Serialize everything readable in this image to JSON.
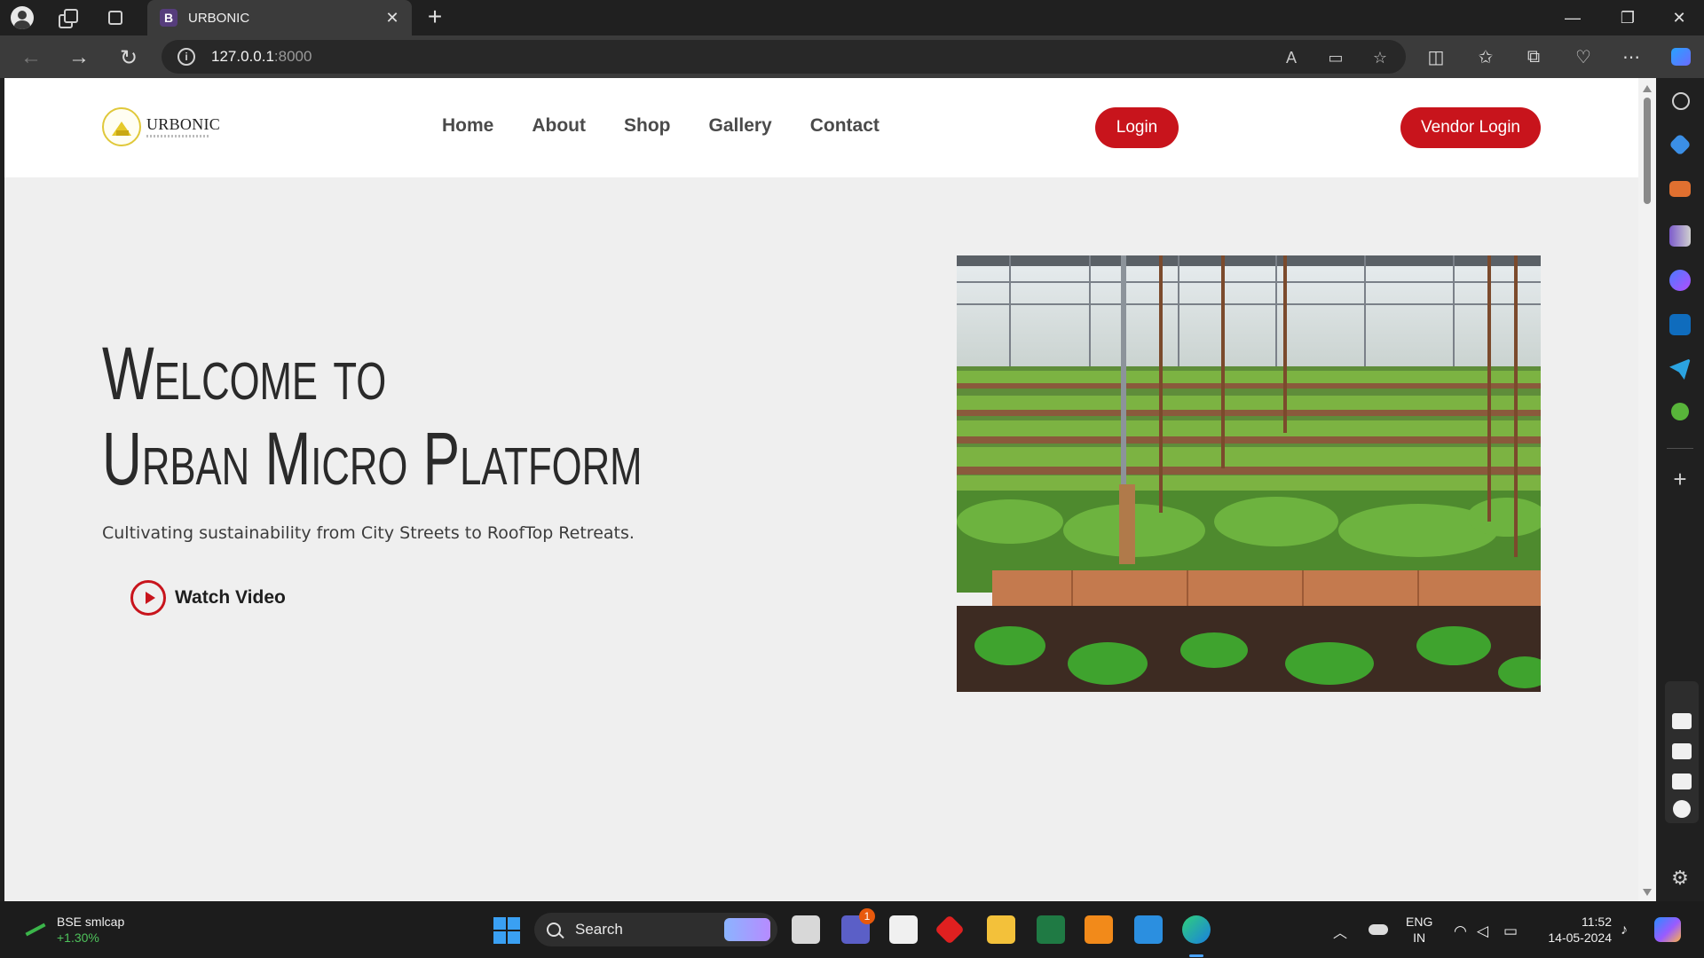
{
  "browser": {
    "tab_favicon_letter": "B",
    "tab_title": "URBONIC",
    "url_host": "127.0.0.1",
    "url_port": ":8000",
    "accent_color": "#202020"
  },
  "site": {
    "logo_text": "URBONIC",
    "nav": [
      "Home",
      "About",
      "Shop",
      "Gallery",
      "Contact"
    ],
    "login_label": "Login",
    "vendor_login_label": "Vendor Login",
    "brand_red": "#c8141c",
    "hero": {
      "heading_line1": "Welcome to",
      "heading_line2": "Urban Micro Platform",
      "subtitle": "Cultivating sustainability from City Streets to RoofTop Retreats.",
      "watch_video_label": "Watch Video"
    }
  },
  "taskbar": {
    "stock_name": "BSE smlcap",
    "stock_change": "+1.30%",
    "search_label": "Search",
    "teams_badge": "1",
    "lang_line1": "ENG",
    "lang_line2": "IN",
    "time": "11:52",
    "date": "14-05-2024"
  }
}
